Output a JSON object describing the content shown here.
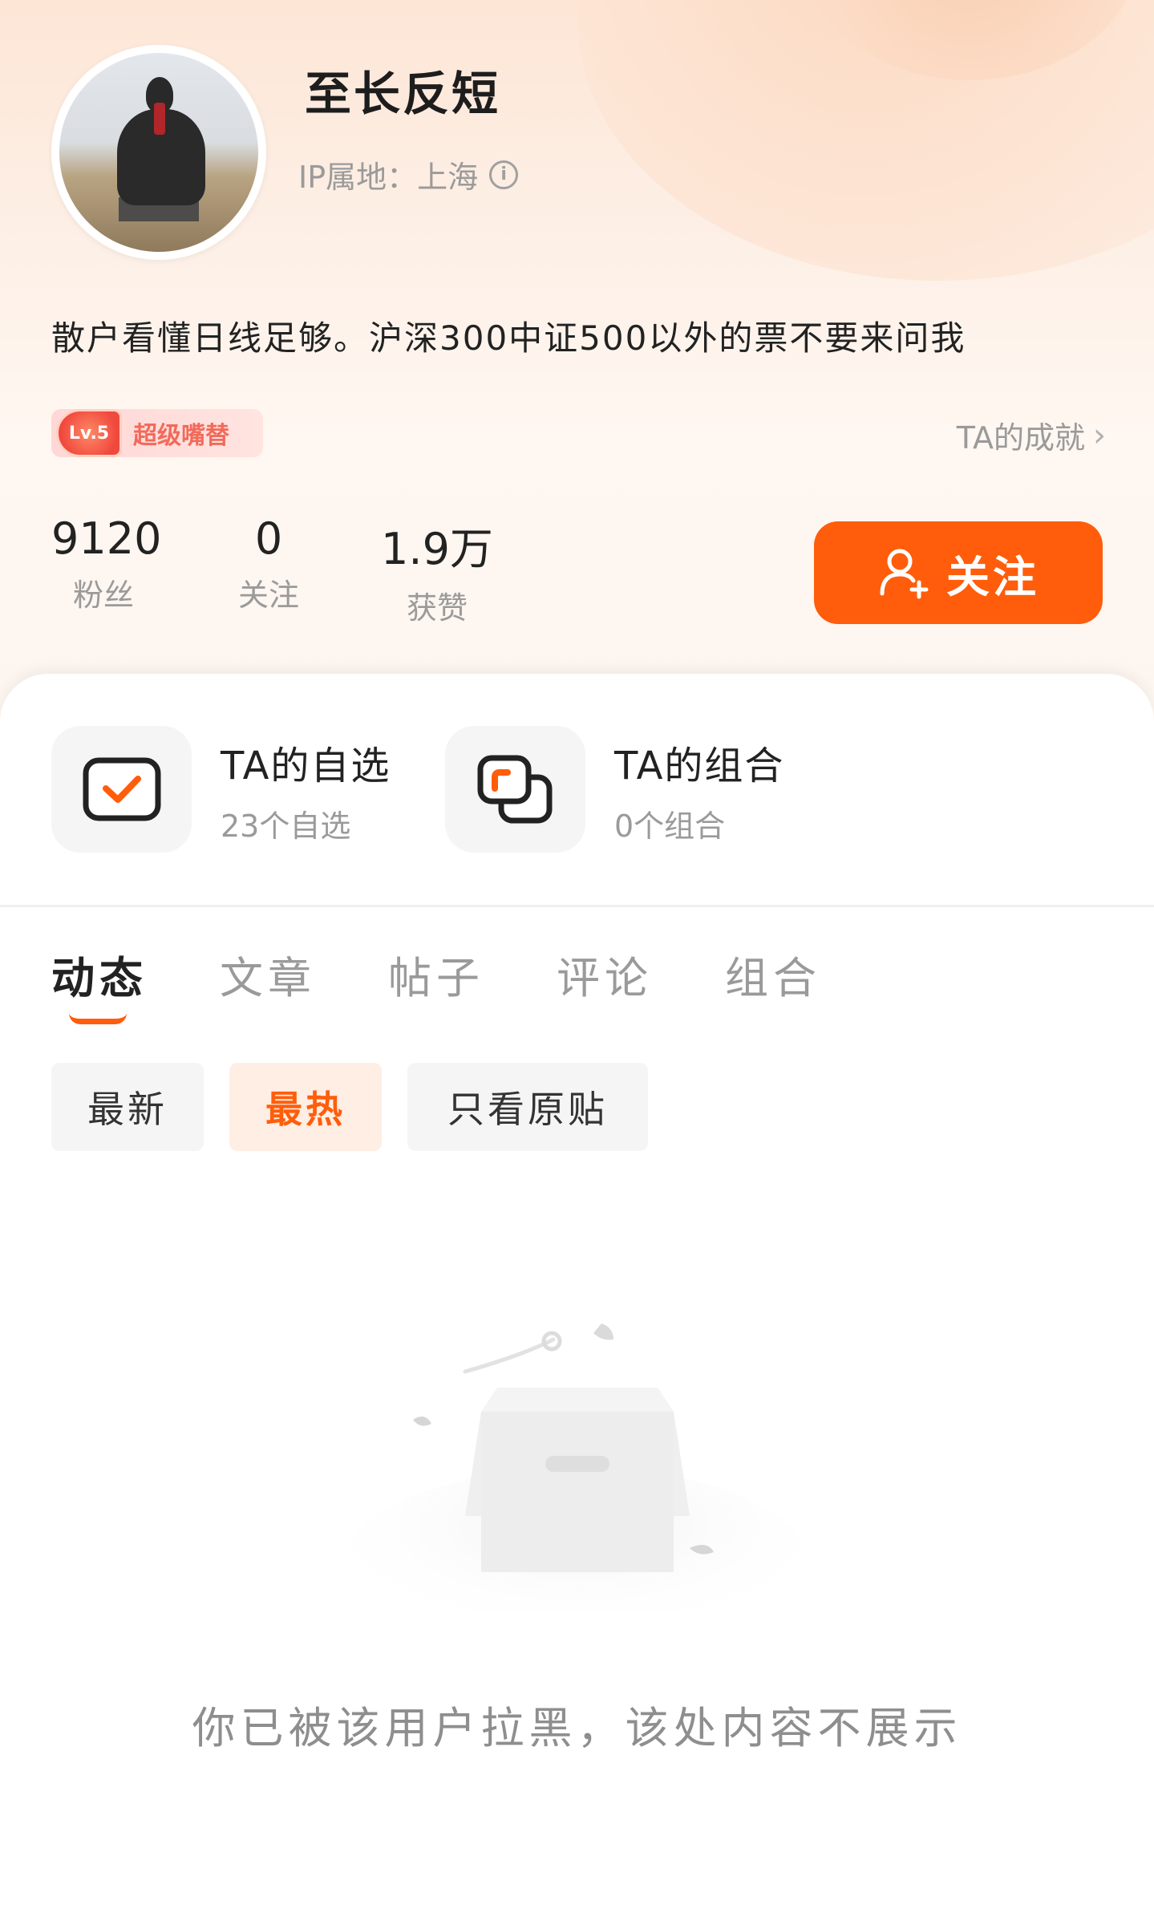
{
  "profile": {
    "username": "至长反短",
    "ip_location": "IP属地：上海",
    "bio": "散户看懂日线足够。沪深300中证500以外的票不要来问我",
    "badge_level": "Lv.5",
    "badge_title": "超级嘴替",
    "achievement_link": "TA的成就"
  },
  "stats": [
    {
      "value": "9120",
      "label": "粉丝"
    },
    {
      "value": "0",
      "label": "关注"
    },
    {
      "value": "1.9万",
      "label": "获赞"
    }
  ],
  "follow_button": "关注",
  "quick_links": [
    {
      "title": "TA的自选",
      "subtitle": "23个自选"
    },
    {
      "title": "TA的组合",
      "subtitle": "0个组合"
    }
  ],
  "tabs": [
    "动态",
    "文章",
    "帖子",
    "评论",
    "组合"
  ],
  "active_tab": "动态",
  "filters": [
    "最新",
    "最热",
    "只看原贴"
  ],
  "selected_filter": "最热",
  "empty_message": "你已被该用户拉黑，该处内容不展示",
  "colors": {
    "accent": "#ff5d0b",
    "badge": "#f26a5a"
  }
}
